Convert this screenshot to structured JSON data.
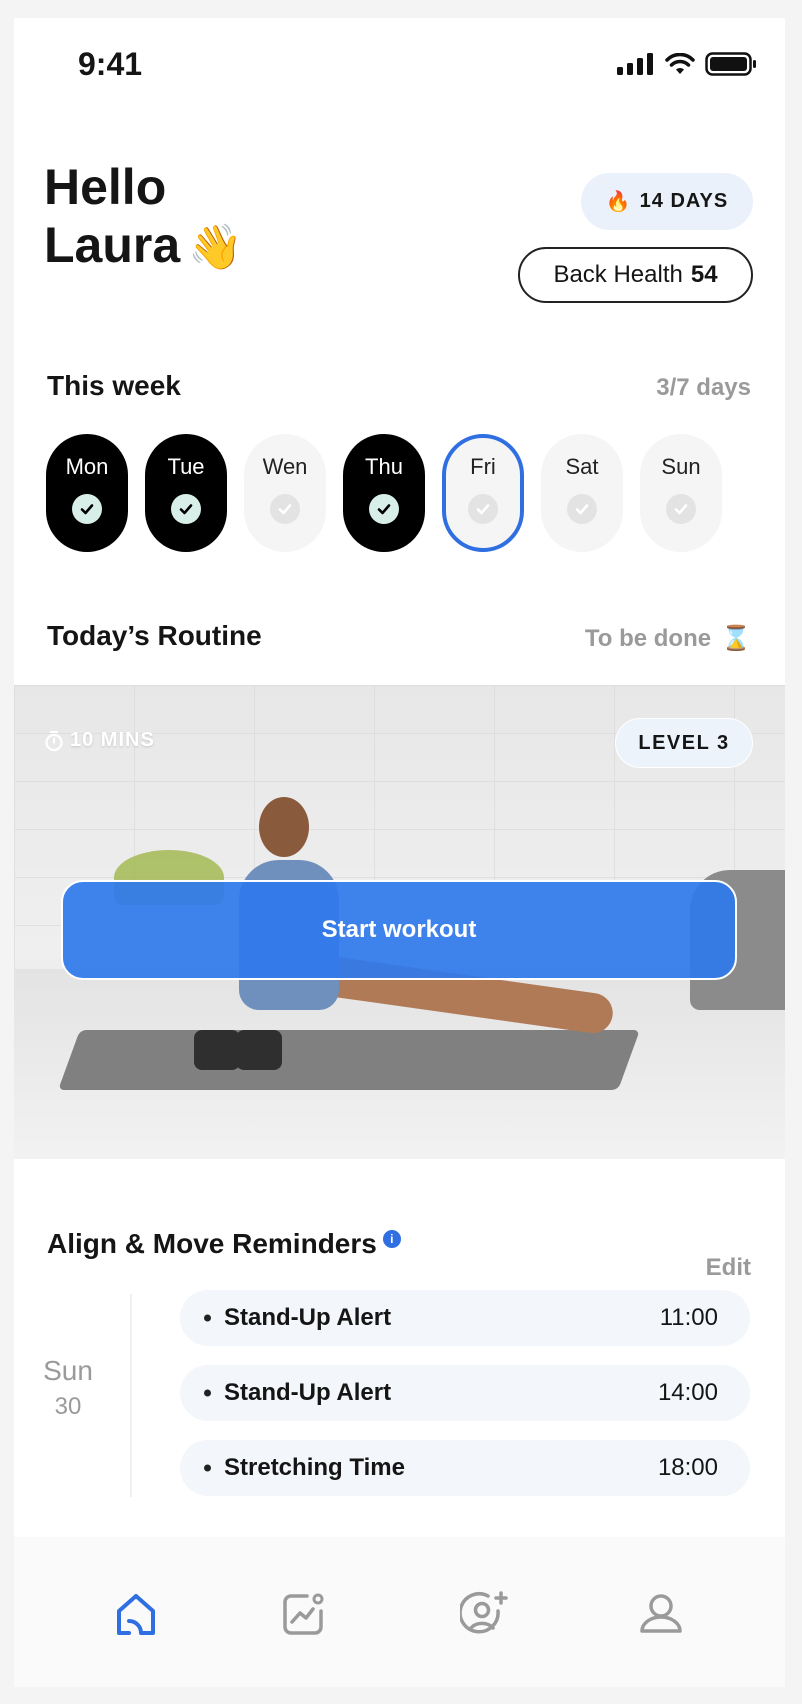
{
  "status": {
    "time": "9:41"
  },
  "greeting": {
    "line1": "Hello",
    "line2": "Laura",
    "emoji": "👋"
  },
  "streak": {
    "icon": "🔥",
    "label": "14 DAYS"
  },
  "back_health": {
    "label": "Back Health",
    "score": "54"
  },
  "week": {
    "title": "This week",
    "progress": "3/7 days",
    "days": [
      {
        "label": "Mon",
        "state": "done"
      },
      {
        "label": "Tue",
        "state": "done"
      },
      {
        "label": "Wen",
        "state": "pending"
      },
      {
        "label": "Thu",
        "state": "done"
      },
      {
        "label": "Fri",
        "state": "today"
      },
      {
        "label": "Sat",
        "state": "pending"
      },
      {
        "label": "Sun",
        "state": "pending"
      }
    ]
  },
  "routine": {
    "title": "Today’s Routine",
    "status": "To be done",
    "status_icon": "⌛",
    "duration": "10 MINS",
    "level": "LEVEL 3",
    "start_label": "Start workout"
  },
  "reminders": {
    "title": "Align & Move Reminders",
    "info_icon": "i",
    "edit_label": "Edit",
    "day_name": "Sun",
    "day_number": "30",
    "items": [
      {
        "title": "Stand-Up Alert",
        "time": "11:00"
      },
      {
        "title": "Stand-Up Alert",
        "time": "14:00"
      },
      {
        "title": "Stretching Time",
        "time": "18:00"
      }
    ]
  },
  "nav": {
    "tabs": [
      "home-icon",
      "progress-icon",
      "add-friend-icon",
      "profile-icon"
    ],
    "active_color": "#2f6fe2",
    "inactive_color": "#9a9a9a"
  }
}
